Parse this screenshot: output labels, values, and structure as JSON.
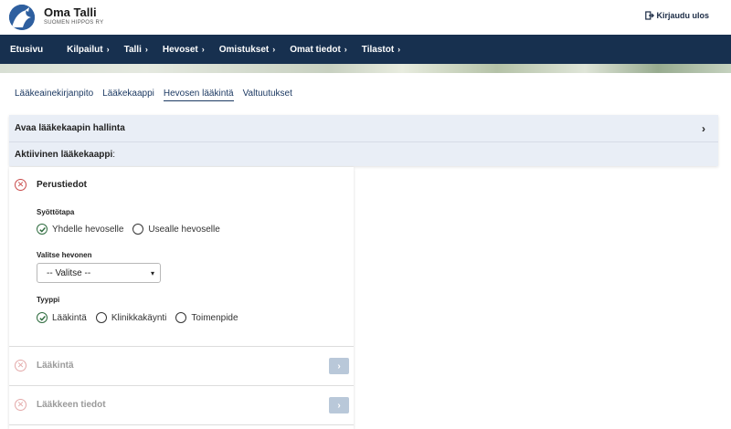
{
  "header": {
    "app_title": "Oma Talli",
    "app_subtitle": "SUOMEN HIPPOS RY",
    "logout_label": "Kirjaudu ulos",
    "logout_icon": "sign-out-icon"
  },
  "nav": {
    "items": [
      {
        "label": "Etusivu",
        "has_chevron": false
      },
      {
        "label": "Kilpailut",
        "has_chevron": true
      },
      {
        "label": "Talli",
        "has_chevron": true
      },
      {
        "label": "Hevoset",
        "has_chevron": true
      },
      {
        "label": "Omistukset",
        "has_chevron": true
      },
      {
        "label": "Omat tiedot",
        "has_chevron": true
      },
      {
        "label": "Tilastot",
        "has_chevron": true
      }
    ]
  },
  "tabs": [
    {
      "label": "Lääkeainekirjanpito",
      "active": false
    },
    {
      "label": "Lääkekaappi",
      "active": false
    },
    {
      "label": "Hevosen lääkintä",
      "active": true
    },
    {
      "label": "Valtuutukset",
      "active": false
    }
  ],
  "cabinet": {
    "open_label": "Avaa lääkekaapin hallinta",
    "active_label": "Aktiivinen lääkekaappi",
    "active_suffix": ":"
  },
  "basic_info": {
    "title": "Perustiedot",
    "input_mode": {
      "label": "Syöttötapa",
      "options": [
        {
          "label": "Yhdelle hevoselle",
          "checked": true
        },
        {
          "label": "Usealle hevoselle",
          "checked": false
        }
      ]
    },
    "horse_select": {
      "label": "Valitse hevonen",
      "value": "-- Valitse --"
    },
    "type": {
      "label": "Tyyppi",
      "options": [
        {
          "label": "Lääkintä",
          "checked": true
        },
        {
          "label": "Klinikkakäynti",
          "checked": false
        },
        {
          "label": "Toimenpide",
          "checked": false
        }
      ]
    }
  },
  "sections": [
    {
      "title": "Lääkintä"
    },
    {
      "title": "Lääkkeen tiedot"
    }
  ],
  "colors": {
    "navbar": "#17304f",
    "accent": "#1d3a63",
    "error": "#c94a4a",
    "checked": "#2e6b3e",
    "button_disabled": "#b9c8d9"
  }
}
